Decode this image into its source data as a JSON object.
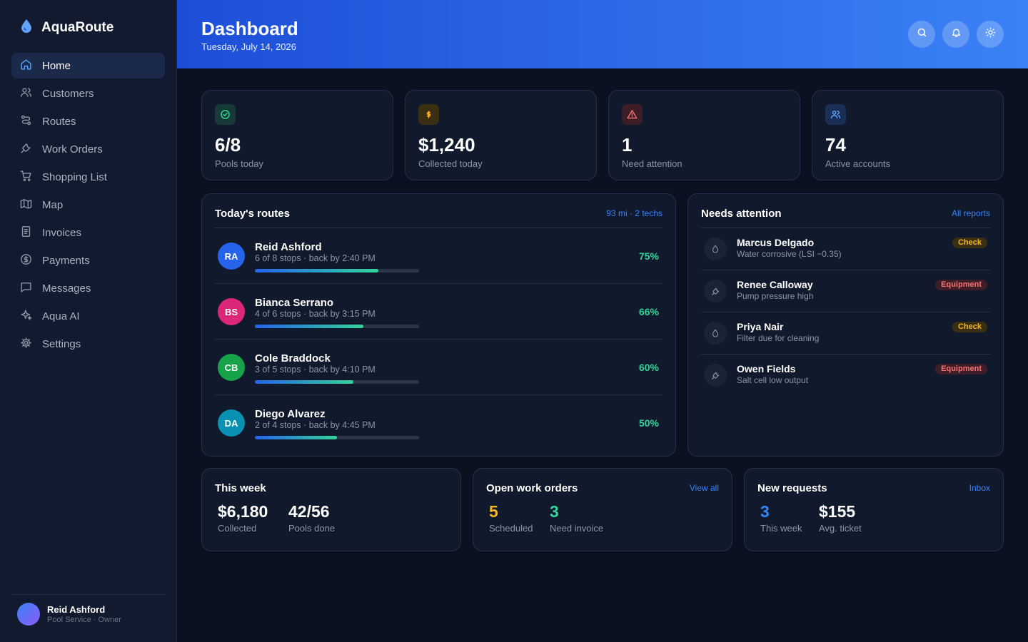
{
  "app": {
    "name": "AquaRoute",
    "logo_icon": "water-drop-icon",
    "accent": "#3b82f6"
  },
  "sidebar": {
    "items": [
      {
        "label": "Home",
        "icon": "home-icon",
        "active": true
      },
      {
        "label": "Customers",
        "icon": "users-icon"
      },
      {
        "label": "Routes",
        "icon": "route-icon"
      },
      {
        "label": "Work Orders",
        "icon": "wrench-icon"
      },
      {
        "label": "Shopping List",
        "icon": "cart-icon"
      },
      {
        "label": "Map",
        "icon": "map-icon"
      },
      {
        "label": "Invoices",
        "icon": "invoice-icon"
      },
      {
        "label": "Payments",
        "icon": "dollar-circle-icon"
      },
      {
        "label": "Messages",
        "icon": "message-icon"
      },
      {
        "label": "Aqua AI",
        "icon": "sparkle-icon"
      },
      {
        "label": "Settings",
        "icon": "gear-icon"
      }
    ],
    "user": {
      "name": "Reid Ashford",
      "role": "Pool Service · Owner"
    }
  },
  "header": {
    "title": "Dashboard",
    "date": "Tuesday, July 14, 2026",
    "actions": [
      "search-icon",
      "bell-icon",
      "sun-icon"
    ]
  },
  "stats": [
    {
      "value": "6/8",
      "label": "Pools today",
      "icon": "check-circle-icon",
      "color": "#34d399",
      "bg": "#173a36"
    },
    {
      "value": "$1,240",
      "label": "Collected today",
      "icon": "dollar-icon",
      "color": "#f5b626",
      "bg": "#3a2f12"
    },
    {
      "value": "1",
      "label": "Need attention",
      "icon": "warning-icon",
      "color": "#f87171",
      "bg": "#3f1d27"
    },
    {
      "value": "74",
      "label": "Active accounts",
      "icon": "users-icon",
      "color": "#60a5fa",
      "bg": "#1b2e56"
    }
  ],
  "routes": {
    "title": "Today's routes",
    "summary": "93 mi · 2 techs",
    "items": [
      {
        "initials": "RA",
        "name": "Reid Ashford",
        "detail": "6 of 8 stops · back by 2:40 PM",
        "percent": "75%",
        "progress": 0.75,
        "color": "#2563eb"
      },
      {
        "initials": "BS",
        "name": "Bianca Serrano",
        "detail": "4 of 6 stops · back by 3:15 PM",
        "percent": "66%",
        "progress": 0.66,
        "color": "#db2777"
      },
      {
        "initials": "CB",
        "name": "Cole Braddock",
        "detail": "3 of 5 stops · back by 4:10 PM",
        "percent": "60%",
        "progress": 0.6,
        "color": "#16a34a"
      },
      {
        "initials": "DA",
        "name": "Diego Alvarez",
        "detail": "2 of 4 stops · back by 4:45 PM",
        "percent": "50%",
        "progress": 0.5,
        "color": "#0891b2"
      }
    ]
  },
  "attention": {
    "title": "Needs attention",
    "link": "All reports",
    "items": [
      {
        "name": "Marcus Delgado",
        "detail": "Water corrosive (LSI −0.35)",
        "badge": "Check",
        "type": "check",
        "icon": "water-drop-icon"
      },
      {
        "name": "Renee Calloway",
        "detail": "Pump pressure high",
        "badge": "Equipment",
        "type": "equipment",
        "icon": "wrench-icon"
      },
      {
        "name": "Priya Nair",
        "detail": "Filter due for cleaning",
        "badge": "Check",
        "type": "check",
        "icon": "water-drop-icon"
      },
      {
        "name": "Owen Fields",
        "detail": "Salt cell low output",
        "badge": "Equipment",
        "type": "equipment",
        "icon": "wrench-icon"
      }
    ]
  },
  "week": {
    "title": "This week",
    "metrics": [
      {
        "value": "$6,180",
        "label": "Collected",
        "color": "#ffffff"
      },
      {
        "value": "42/56",
        "label": "Pools done",
        "color": "#ffffff"
      }
    ]
  },
  "work_orders": {
    "title": "Open work orders",
    "link": "View all",
    "metrics": [
      {
        "value": "5",
        "label": "Scheduled",
        "color": "#f5b626"
      },
      {
        "value": "3",
        "label": "Need invoice",
        "color": "#34d399"
      }
    ]
  },
  "requests": {
    "title": "New requests",
    "link": "Inbox",
    "metrics": [
      {
        "value": "3",
        "label": "This week",
        "color": "#3b82f6"
      },
      {
        "value": "$155",
        "label": "Avg. ticket",
        "color": "#ffffff"
      }
    ]
  }
}
